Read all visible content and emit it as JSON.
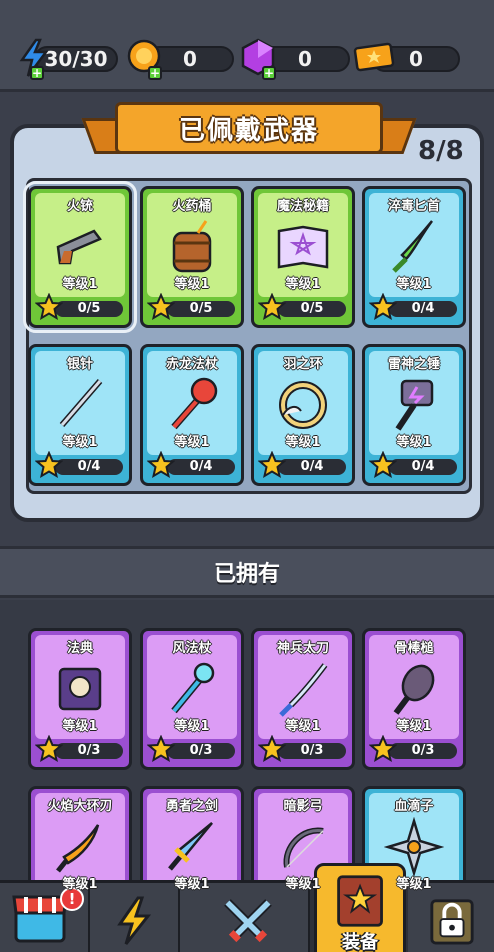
{
  "resources": [
    {
      "icon": "energy-icon",
      "value": "30/30"
    },
    {
      "icon": "gold-coin-icon",
      "value": "0"
    },
    {
      "icon": "purple-gem-icon",
      "value": "0"
    },
    {
      "icon": "ticket-icon",
      "value": "0"
    }
  ],
  "equipped": {
    "title": "已佩戴武器",
    "count": "8/8",
    "cards": [
      {
        "name": "火铳",
        "level": "等级1",
        "progress": "0/5",
        "rarity": "green",
        "icon": "revolver-icon"
      },
      {
        "name": "火药桶",
        "level": "等级1",
        "progress": "0/5",
        "rarity": "green",
        "icon": "powder-barrel-icon"
      },
      {
        "name": "魔法秘籍",
        "level": "等级1",
        "progress": "0/5",
        "rarity": "green",
        "icon": "spellbook-icon"
      },
      {
        "name": "淬毒匕首",
        "level": "等级1",
        "progress": "0/4",
        "rarity": "blue",
        "icon": "poison-dagger-icon"
      },
      {
        "name": "银针",
        "level": "等级1",
        "progress": "0/4",
        "rarity": "blue",
        "icon": "silver-needle-icon"
      },
      {
        "name": "赤龙法杖",
        "level": "等级1",
        "progress": "0/4",
        "rarity": "blue",
        "icon": "dragon-staff-icon"
      },
      {
        "name": "羽之环",
        "level": "等级1",
        "progress": "0/4",
        "rarity": "blue",
        "icon": "feather-ring-icon"
      },
      {
        "name": "雷神之锤",
        "level": "等级1",
        "progress": "0/4",
        "rarity": "blue",
        "icon": "thunder-hammer-icon"
      }
    ]
  },
  "owned": {
    "title": "已拥有",
    "cards": [
      {
        "name": "法典",
        "level": "等级1",
        "progress": "0/3",
        "rarity": "purple",
        "icon": "codex-icon"
      },
      {
        "name": "风法杖",
        "level": "等级1",
        "progress": "0/3",
        "rarity": "purple",
        "icon": "wind-staff-icon"
      },
      {
        "name": "神兵太刀",
        "level": "等级1",
        "progress": "0/3",
        "rarity": "purple",
        "icon": "katana-icon"
      },
      {
        "name": "骨棒槌",
        "level": "等级1",
        "progress": "0/3",
        "rarity": "purple",
        "icon": "spiked-club-icon"
      },
      {
        "name": "火焰大环刃",
        "level": "等级1",
        "rarity": "purple",
        "icon": "flame-blade-icon"
      },
      {
        "name": "勇者之剑",
        "level": "等级1",
        "rarity": "purple",
        "icon": "hero-sword-icon"
      },
      {
        "name": "暗影弓",
        "level": "等级1",
        "rarity": "purple",
        "icon": "shadow-bow-icon"
      },
      {
        "name": "血滴子",
        "level": "等级1",
        "rarity": "blue",
        "icon": "shuriken-icon"
      }
    ]
  },
  "nav": [
    {
      "icon": "shop-icon",
      "badge": "!"
    },
    {
      "icon": "lightning-icon"
    },
    {
      "icon": "crossed-swords-icon"
    },
    {
      "icon": "equipment-book-icon",
      "label": "装备",
      "active": true
    },
    {
      "icon": "locked-icon"
    }
  ]
}
